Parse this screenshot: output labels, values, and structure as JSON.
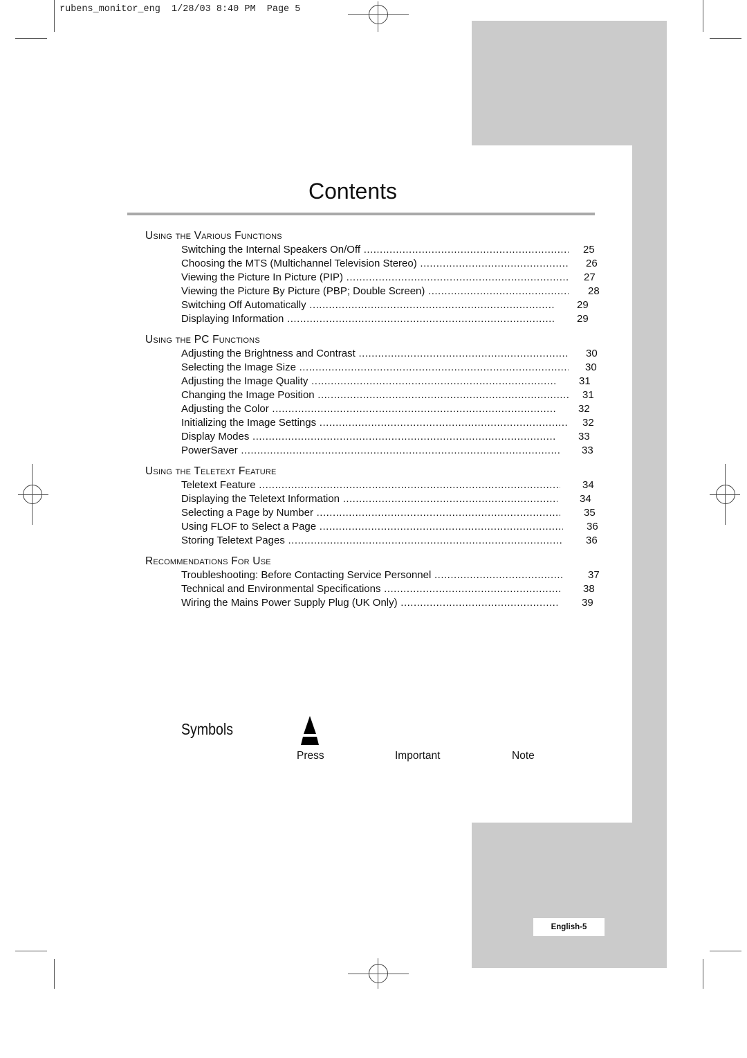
{
  "slug": "rubens_monitor_eng  1/28/03 8:40 PM  Page 5",
  "title": "Contents",
  "sections": [
    {
      "heading": "Using the Various Functions",
      "entries": [
        {
          "label": "Switching the Internal Speakers On/Off",
          "page": "25"
        },
        {
          "label": "Choosing the MTS (Multichannel Television Stereo)",
          "page": "26"
        },
        {
          "label": "Viewing the Picture In Picture (PIP)",
          "page": "27"
        },
        {
          "label": "Viewing the Picture By Picture (PBP; Double Screen)",
          "page": "28"
        },
        {
          "label": "Switching Off Automatically",
          "page": "29"
        },
        {
          "label": "Displaying Information",
          "page": "29"
        }
      ]
    },
    {
      "heading": "Using the PC Functions",
      "entries": [
        {
          "label": "Adjusting the Brightness and Contrast",
          "page": "30"
        },
        {
          "label": "Selecting the Image Size",
          "page": "30"
        },
        {
          "label": "Adjusting the Image Quality",
          "page": "31"
        },
        {
          "label": "Changing the Image Position",
          "page": "31"
        },
        {
          "label": "Adjusting the Color",
          "page": "32"
        },
        {
          "label": "Initializing the Image Settings",
          "page": "32"
        },
        {
          "label": "Display Modes",
          "page": "33"
        },
        {
          "label": "PowerSaver",
          "page": "33"
        }
      ]
    },
    {
      "heading": "Using the Teletext Feature",
      "entries": [
        {
          "label": "Teletext Feature",
          "page": "34"
        },
        {
          "label": "Displaying the Teletext Information",
          "page": "34"
        },
        {
          "label": "Selecting a Page by Number",
          "page": "35"
        },
        {
          "label": "Using FLOF to Select a Page",
          "page": "36"
        },
        {
          "label": "Storing Teletext Pages",
          "page": "36"
        }
      ]
    },
    {
      "heading": "Recommendations For Use",
      "entries": [
        {
          "label": "Troubleshooting: Before Contacting Service Personnel",
          "page": "37"
        },
        {
          "label": "Technical and Environmental Specifications",
          "page": "38"
        },
        {
          "label": "Wiring the Mains Power Supply Plug (UK Only)",
          "page": "39"
        }
      ]
    }
  ],
  "symbols": {
    "heading": "Symbols",
    "items": [
      {
        "label": "Press",
        "icon": "press-icon"
      },
      {
        "label": "Important",
        "icon": ""
      },
      {
        "label": "Note",
        "icon": ""
      }
    ]
  },
  "footer": {
    "page_label": "English-5"
  },
  "colors": {
    "panel_gray": "#cbcbcb",
    "rule_gray": "#a9a9a9"
  }
}
